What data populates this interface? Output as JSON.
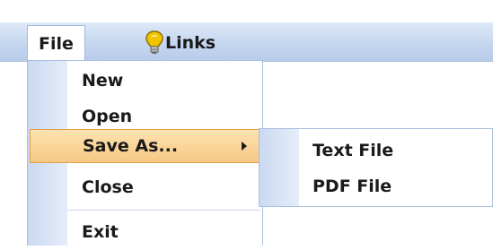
{
  "menubar": {
    "items": [
      {
        "label": "File",
        "icon": null
      },
      {
        "label": "Links",
        "icon": "lightbulb-icon"
      }
    ]
  },
  "file_menu": {
    "items": [
      "New",
      "Open",
      "Save As...",
      "Close",
      "Exit"
    ],
    "highlighted": "Save As..."
  },
  "save_as_submenu": {
    "items": [
      "Text File",
      "PDF File"
    ]
  },
  "colors": {
    "menubar": "#c7d8f0",
    "highlight": "#f7c783",
    "highlight_border": "#e0a04d",
    "icon_strip": "#cad9f1",
    "bulb": "#f2c400"
  }
}
